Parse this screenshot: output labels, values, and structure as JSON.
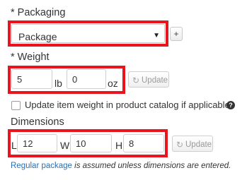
{
  "packaging": {
    "label": "* Packaging",
    "selected": "Package",
    "add_label": "+"
  },
  "weight": {
    "label": "* Weight",
    "lb_value": "5",
    "lb_unit": "lb",
    "oz_value": "0",
    "oz_unit": "oz",
    "update_label": "Update",
    "checkbox_label": "Update item weight in product catalog if applicable"
  },
  "dimensions": {
    "label": "Dimensions",
    "l_label": "L",
    "l_value": "12",
    "w_label": "W",
    "w_value": "10",
    "h_label": "H",
    "h_value": "8",
    "update_label": "Update"
  },
  "note": {
    "link_text": "Regular package",
    "rest_text": " is assumed unless dimensions are entered."
  },
  "colors": {
    "highlight": "#e8141e",
    "link": "#2a6fb0"
  },
  "icons": {
    "refresh": "refresh-icon",
    "help": "question-circle-icon",
    "dropdown": "chevron-down-icon"
  }
}
